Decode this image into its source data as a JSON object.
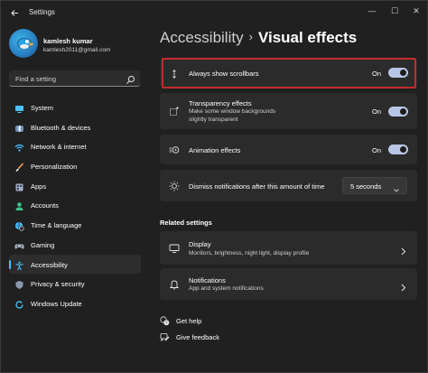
{
  "window": {
    "app_title": "Settings",
    "controls": {
      "minimize": "—",
      "maximize": "☐",
      "close": "✕"
    }
  },
  "profile": {
    "name": "kamlesh kumar",
    "email": "kamlesh2011@gmail.com"
  },
  "search": {
    "placeholder": "Find a setting"
  },
  "sidebar": {
    "items": [
      {
        "label": "System",
        "icon": "monitor-icon"
      },
      {
        "label": "Bluetooth & devices",
        "icon": "bluetooth-icon"
      },
      {
        "label": "Network & internet",
        "icon": "wifi-icon"
      },
      {
        "label": "Personalization",
        "icon": "brush-icon"
      },
      {
        "label": "Apps",
        "icon": "apps-icon"
      },
      {
        "label": "Accounts",
        "icon": "person-icon"
      },
      {
        "label": "Time & language",
        "icon": "globe-clock-icon"
      },
      {
        "label": "Gaming",
        "icon": "gamepad-icon"
      },
      {
        "label": "Accessibility",
        "icon": "accessibility-icon",
        "active": true
      },
      {
        "label": "Privacy & security",
        "icon": "shield-icon"
      },
      {
        "label": "Windows Update",
        "icon": "update-icon"
      }
    ]
  },
  "breadcrumb": {
    "parent": "Accessibility",
    "separator": "›",
    "current": "Visual effects"
  },
  "settings": {
    "scrollbars": {
      "title": "Always show scrollbars",
      "state": "On",
      "on": true
    },
    "transparency": {
      "title": "Transparency effects",
      "desc": "Make some window backgrounds slightly transparent",
      "state": "On",
      "on": true
    },
    "animation": {
      "title": "Animation effects",
      "state": "On",
      "on": true
    },
    "notifications": {
      "title": "Dismiss notifications after this amount of time",
      "value": "5 seconds"
    }
  },
  "related": {
    "heading": "Related settings",
    "display": {
      "title": "Display",
      "desc": "Monitors, brightness, night light, display profile"
    },
    "notifications": {
      "title": "Notifications",
      "desc": "App and system notifications"
    }
  },
  "help": {
    "get_help": "Get help",
    "feedback": "Give feedback"
  },
  "colors": {
    "accent": "#4cc2ff",
    "toggle_on": "#b8c6e6",
    "highlight": "#c42b2b",
    "background": "#202020",
    "card": "#2b2b2b"
  }
}
